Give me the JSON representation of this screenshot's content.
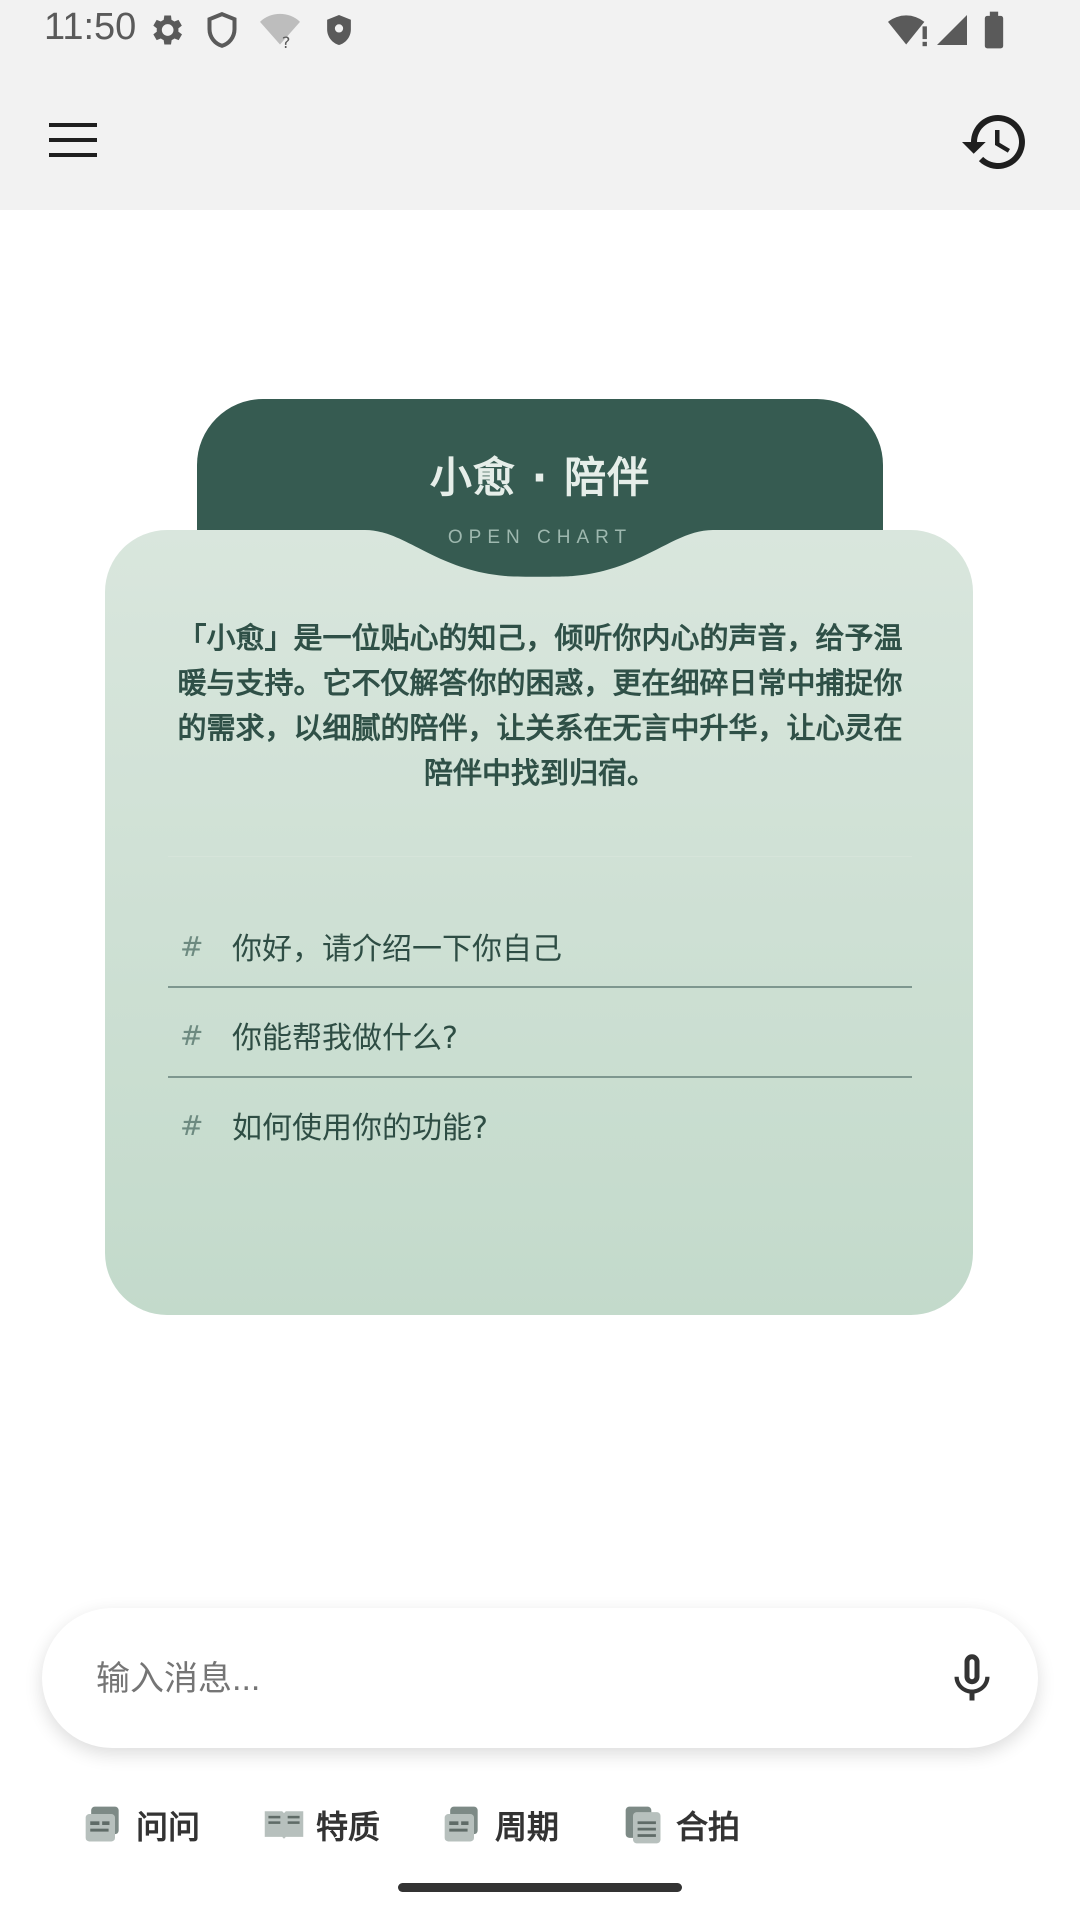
{
  "status_bar": {
    "time": "11:50",
    "icons": [
      "settings-icon",
      "shield-icon",
      "wifi-question-icon",
      "shield-filled-icon",
      "wifi-icon",
      "signal-icon",
      "battery-icon"
    ]
  },
  "app_bar": {
    "menu_icon": "menu-icon",
    "history_icon": "history-icon"
  },
  "card": {
    "title": "小愈 · 陪伴",
    "subtitle": "OPEN CHART",
    "description": "「小愈」是一位贴心的知己，倾听你内心的声音，给予温暖与支持。它不仅解答你的困惑，更在细碎日常中捕捉你的需求，以细腻的陪伴，让关系在无言中升华，让心灵在陪伴中找到归宿。",
    "prompts": [
      {
        "hash": "#",
        "text": "你好，请介绍一下你自己"
      },
      {
        "hash": "#",
        "text": "你能帮我做什么?"
      },
      {
        "hash": "#",
        "text": "如何使用你的功能?"
      }
    ],
    "colors": {
      "header": "#365b51",
      "body_top": "#d9e6dd",
      "body_bottom": "#c3dacb"
    }
  },
  "input": {
    "placeholder": "输入消息...",
    "mic_icon": "mic-icon"
  },
  "bottom_tabs": [
    {
      "label": "问问",
      "icon": "news-icon"
    },
    {
      "label": "特质",
      "icon": "book-icon"
    },
    {
      "label": "周期",
      "icon": "news-icon"
    },
    {
      "label": "合拍",
      "icon": "document-icon"
    }
  ]
}
